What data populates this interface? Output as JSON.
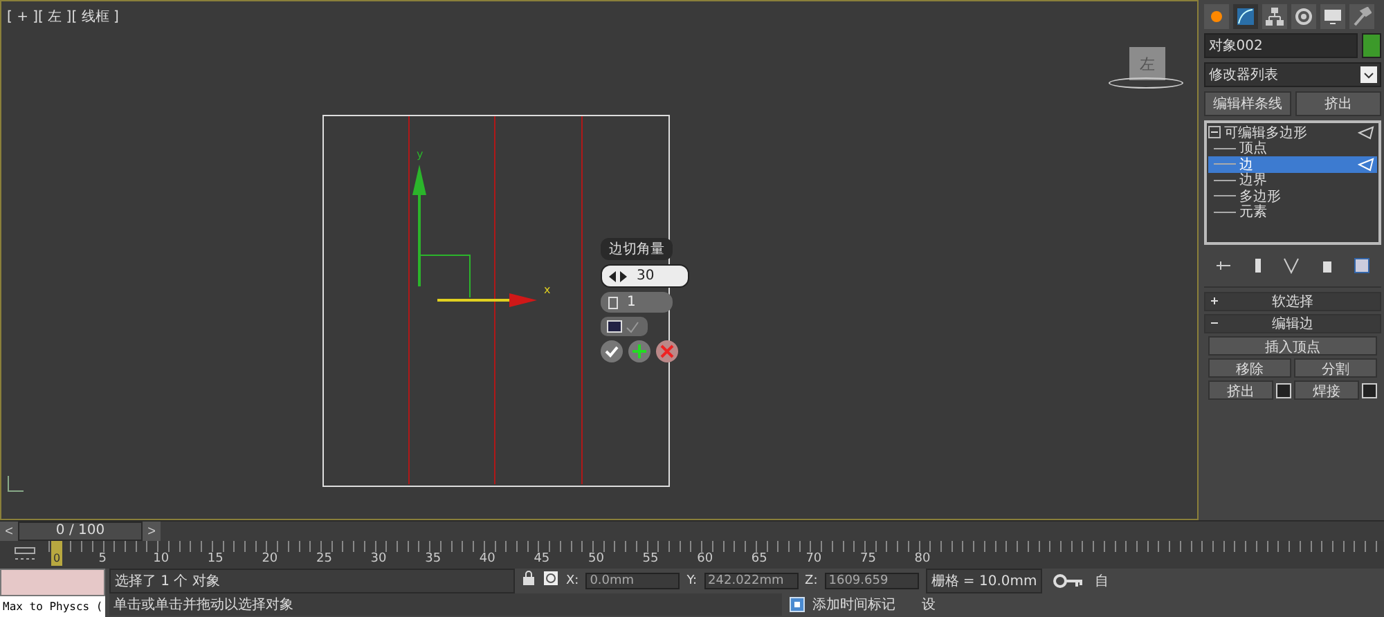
{
  "viewport": {
    "label": "[ + ][ 左 ][ 线框 ]",
    "viewcube_label": "左",
    "gizmo": {
      "y_label": "y",
      "x_label": "x"
    },
    "caddy": {
      "title": "边切角量",
      "amount": "30",
      "segments": "1",
      "open_chamfer": false
    }
  },
  "command_panel": {
    "object_name": "对象002",
    "modifier_list": "修改器列表",
    "quick_buttons": [
      "编辑样条线",
      "挤出"
    ],
    "stack": {
      "label": "可编辑多边形",
      "expanded": true,
      "children": [
        {
          "label": "顶点",
          "selected": false
        },
        {
          "label": "边",
          "selected": true
        },
        {
          "label": "边界",
          "selected": false
        },
        {
          "label": "多边形",
          "selected": false
        },
        {
          "label": "元素",
          "selected": false
        }
      ]
    },
    "rollouts": [
      {
        "title": "软选择",
        "expanded": false
      },
      {
        "title": "编辑边",
        "expanded": true,
        "rows": [
          [
            {
              "label": "插入顶点",
              "settings": false
            }
          ],
          [
            {
              "label": "移除",
              "settings": false
            },
            {
              "label": "分割",
              "settings": false
            }
          ],
          [
            {
              "label": "挤出",
              "settings": true
            },
            {
              "label": "焊接",
              "settings": true
            }
          ]
        ]
      }
    ]
  },
  "timeline": {
    "position": "0 / 100",
    "level": 0,
    "prev": "<",
    "next": ">",
    "current_frame": "0",
    "ticks": [
      "5",
      "10",
      "15",
      "20",
      "25",
      "30",
      "35",
      "40",
      "45",
      "50",
      "55",
      "60",
      "65",
      "70",
      "75",
      "80"
    ]
  },
  "status": {
    "script_label": "Max to Physcs (",
    "selection": "选择了 1 个 对象",
    "prompt": "单击或单击并拖动以选择对象",
    "coords": [
      {
        "label": "X:",
        "value": "0.0mm"
      },
      {
        "label": "Y:",
        "value": "242.022mm"
      },
      {
        "label": "Z:",
        "value": "1609.659"
      }
    ],
    "grid": "栅格 = 10.0mm",
    "time_tag": "添加时间标记",
    "auto_key": "自",
    "set_key": "设"
  }
}
